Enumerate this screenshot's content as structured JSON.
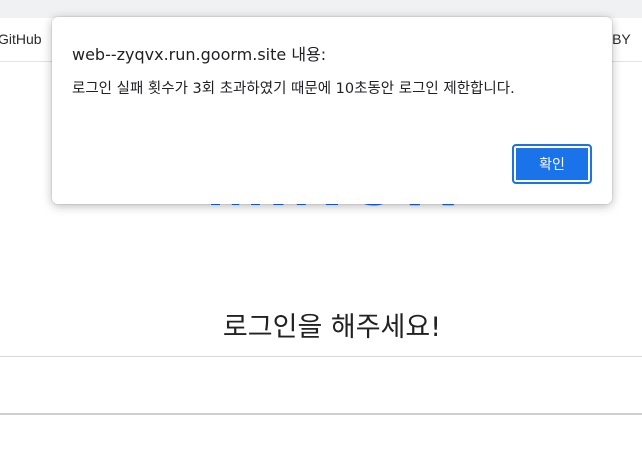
{
  "navbar": {
    "github_label": "GitHub",
    "right_label": "IT BY"
  },
  "logo": {
    "text": "MINOR"
  },
  "main": {
    "login_prompt": "로그인을 해주세요!"
  },
  "dialog": {
    "title": "web--zyqvx.run.goorm.site 내용:",
    "message": "로그인 실패 횟수가 3회 초과하였기 때문에 10초동안 로그인 제한합니다.",
    "ok_label": "확인"
  },
  "colors": {
    "accent": "#1a73e8",
    "logo": "#1f6fe8",
    "topstrip": "#eff1f3"
  }
}
